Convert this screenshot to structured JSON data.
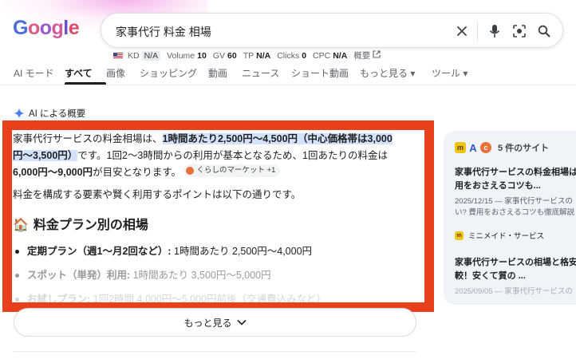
{
  "logo": {
    "letters": [
      "G",
      "o",
      "o",
      "g",
      "l",
      "e"
    ]
  },
  "search": {
    "query": "家事代行 料金 相場"
  },
  "seo_bar": {
    "kd_label": "KD",
    "kd_value": "N/A",
    "volume_label": "Volume",
    "volume_value": "10",
    "gv_label": "GV",
    "gv_value": "60",
    "tp_label": "TP",
    "tp_value": "N/A",
    "clicks_label": "Clicks",
    "clicks_value": "0",
    "cpc_label": "CPC",
    "cpc_value": "N/A",
    "overview_label": "概要"
  },
  "tabs": [
    {
      "label": "AI モード"
    },
    {
      "label": "すべて"
    },
    {
      "label": "画像"
    },
    {
      "label": "ショッピング"
    },
    {
      "label": "動画"
    },
    {
      "label": "ニュース"
    },
    {
      "label": "ショート動画"
    },
    {
      "label": "もっと見る ▾"
    },
    {
      "label": "ツール ▾"
    }
  ],
  "ai_overview": {
    "title": "AI による概要",
    "p1_a": "家事代行サービスの料金相場は、",
    "p1_hl": "1時間あたり2,500円〜4,500円（中心価格帯は3,000円〜3,500円）",
    "p1_b": "です。1回2〜3時間からの利用が基本となるため、1回あたりの料金は",
    "p1_bold": "6,000円〜9,000円",
    "p1_c": "が目安となります。",
    "chip_label": "くらしのマーケット +1",
    "p2": "料金を構成する要素や賢く利用するポイントは以下の通りです。",
    "heading": "料金プラン別の相場",
    "heading_emoji": "🏠",
    "items": [
      {
        "label": "定期プラン（週1〜月2回など）:",
        "text": " 1時間あたり 2,500円〜4,000円"
      },
      {
        "label": "スポット（単発）利用:",
        "text": " 1時間あたり 3,500円〜5,000円"
      },
      {
        "label": "お試しプラン:",
        "text": " 1回2時間 4,000円〜5,000円前後（交通費込みなど）"
      }
    ],
    "more_label": "もっと見る"
  },
  "side": {
    "count_label": "5 件のサイト",
    "src1_title_a": "家事代行サービスの料金相場は",
    "src1_title_b": "用をおさえるコツも...",
    "src1_date_a": "2025/12/15 — 家事代行サービスの",
    "src1_date_b": "い? 費用をおさえるコツも徹底解説",
    "site2": "ミニメイド・サービス",
    "src2_title_a": "家事代行サービスの相場と格安",
    "src2_title_b": "較！安くて質の ...",
    "src2_date": "2025/09/05 — 家事代行サービスの"
  },
  "colors": {
    "highlight": "#d3e3fd",
    "frame": "#e8401c",
    "card": "#f0f4f9"
  }
}
